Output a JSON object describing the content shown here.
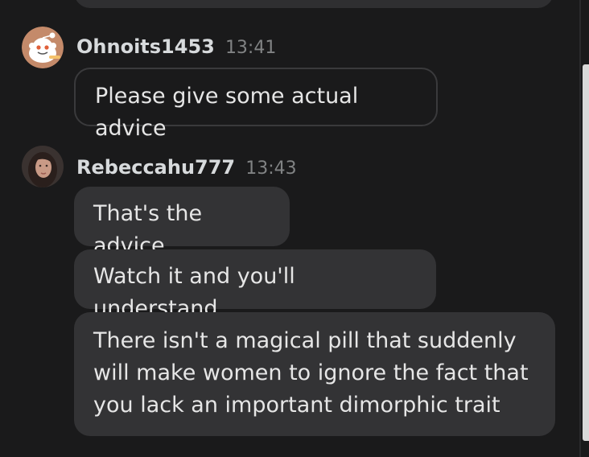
{
  "messages": [
    {
      "user": "Ohnoits1453",
      "time": "13:41",
      "avatar": "reddit-snoo-avatar",
      "bubbles": [
        "Please give some actual advice"
      ]
    },
    {
      "user": "Rebeccahu777",
      "time": "13:43",
      "avatar": "profile-photo-avatar",
      "bubbles": [
        "That's the advice",
        "Watch it and you'll understand",
        "There isn't a magical pill that suddenly will make women to ignore the fact that you lack an important dimorphic trait"
      ]
    }
  ],
  "colors": {
    "background": "#1a1a1b",
    "bubble": "#333335",
    "username": "#d7dadc",
    "timestamp": "#818384"
  }
}
